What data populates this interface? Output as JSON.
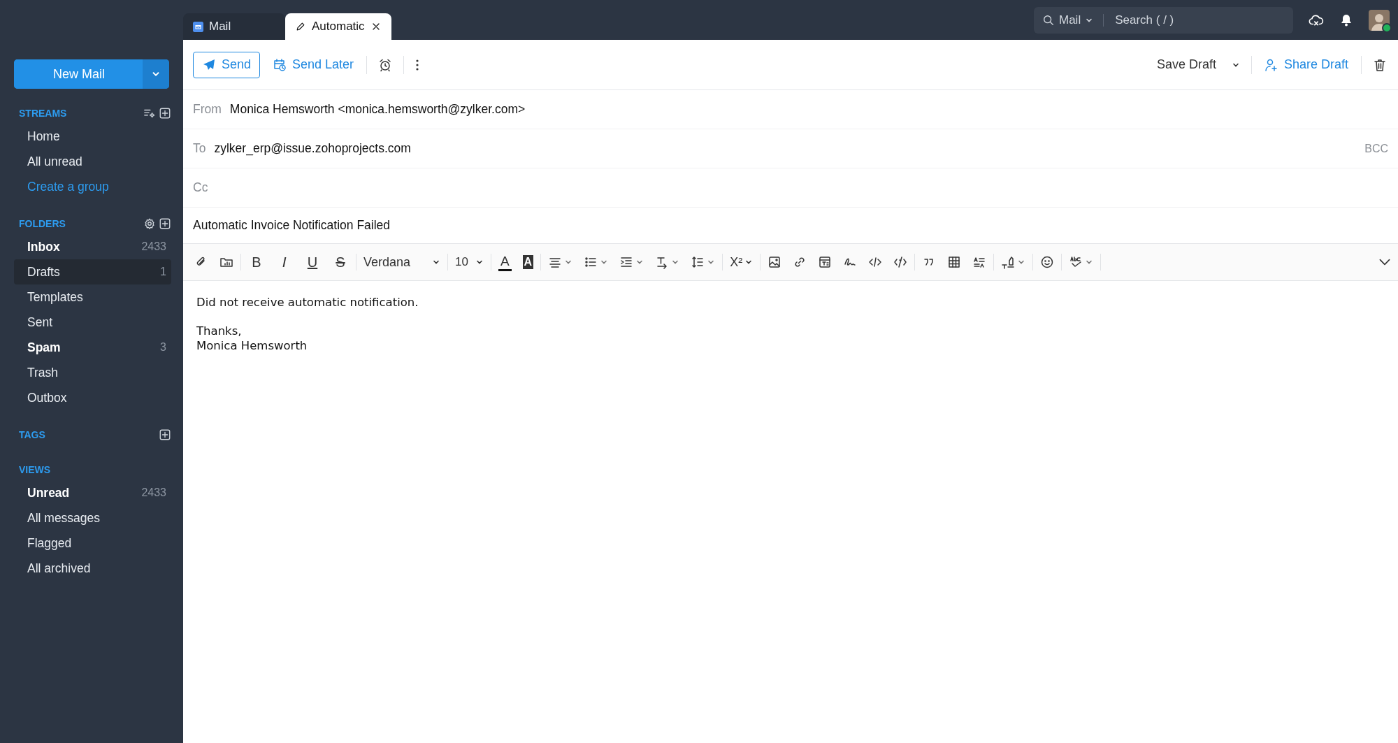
{
  "tabs": [
    {
      "label": "Mail",
      "kind": "mail",
      "selected": false,
      "closable": false
    },
    {
      "label": "Automatic",
      "kind": "draft",
      "selected": true,
      "closable": true
    }
  ],
  "search": {
    "scope": "Mail",
    "placeholder": "Search ( / )"
  },
  "new_mail": {
    "label": "New Mail"
  },
  "sidebar": {
    "sections": [
      {
        "title": "STREAMS",
        "actions": [
          {
            "kind": "filter-settings"
          },
          {
            "kind": "add"
          }
        ],
        "items": [
          {
            "label": "Home",
            "kind": "item",
            "bold": false,
            "selected": false
          },
          {
            "label": "All unread",
            "kind": "item",
            "bold": false,
            "selected": false
          },
          {
            "label": "Create a group",
            "kind": "link",
            "bold": false,
            "selected": false
          }
        ]
      },
      {
        "title": "FOLDERS",
        "actions": [
          {
            "kind": "settings"
          },
          {
            "kind": "add"
          }
        ],
        "items": [
          {
            "label": "Inbox",
            "kind": "item",
            "bold": true,
            "selected": false,
            "count": "2433"
          },
          {
            "label": "Drafts",
            "kind": "item",
            "bold": false,
            "selected": true,
            "count": "1"
          },
          {
            "label": "Templates",
            "kind": "item",
            "bold": false,
            "selected": false
          },
          {
            "label": "Sent",
            "kind": "item",
            "bold": false,
            "selected": false
          },
          {
            "label": "Spam",
            "kind": "item",
            "bold": true,
            "selected": false,
            "count": "3"
          },
          {
            "label": "Trash",
            "kind": "item",
            "bold": false,
            "selected": false
          },
          {
            "label": "Outbox",
            "kind": "item",
            "bold": false,
            "selected": false
          }
        ]
      },
      {
        "title": "TAGS",
        "actions": [
          {
            "kind": "add"
          }
        ]
      },
      {
        "title": "VIEWS",
        "items": [
          {
            "label": "Unread",
            "kind": "item",
            "bold": true,
            "selected": false,
            "count": "2433"
          },
          {
            "label": "All messages",
            "kind": "item",
            "bold": false,
            "selected": false
          },
          {
            "label": "Flagged",
            "kind": "item",
            "bold": false,
            "selected": false
          },
          {
            "label": "All archived",
            "kind": "item",
            "bold": false,
            "selected": false
          }
        ]
      }
    ]
  },
  "compose": {
    "send": "Send",
    "send_later": "Send Later",
    "save_draft": "Save Draft",
    "share_draft": "Share Draft",
    "from": {
      "label": "From",
      "value": "Monica Hemsworth <monica.hemsworth@zylker.com>"
    },
    "to": {
      "label": "To",
      "value": "zylker_erp@issue.zohoprojects.com",
      "bcc": "BCC"
    },
    "cc": {
      "label": "Cc"
    },
    "subject": "Automatic Invoice Notification Failed",
    "toolbar": [
      {
        "kind": "attach"
      },
      {
        "kind": "cloud-attach"
      },
      {
        "kind": "sep"
      },
      {
        "kind": "bold",
        "text": "B"
      },
      {
        "kind": "italic",
        "text": "I"
      },
      {
        "kind": "underline",
        "text": "U"
      },
      {
        "kind": "strike",
        "text": "S"
      },
      {
        "kind": "sep"
      },
      {
        "kind": "font",
        "text": "Verdana",
        "menu": true
      },
      {
        "kind": "sep"
      },
      {
        "kind": "size",
        "text": "10",
        "menu": true
      },
      {
        "kind": "sep"
      },
      {
        "kind": "font-color",
        "text": "A"
      },
      {
        "kind": "bg-color",
        "text": "A"
      },
      {
        "kind": "sep"
      },
      {
        "kind": "align",
        "menu": true
      },
      {
        "kind": "list",
        "menu": true
      },
      {
        "kind": "indent",
        "menu": true
      },
      {
        "kind": "direction",
        "menu": true
      },
      {
        "kind": "line-spacing",
        "menu": true
      },
      {
        "kind": "sep"
      },
      {
        "kind": "superscript",
        "text": "X²",
        "menu": true
      },
      {
        "kind": "sep"
      },
      {
        "kind": "image"
      },
      {
        "kind": "link"
      },
      {
        "kind": "template"
      },
      {
        "kind": "signature"
      },
      {
        "kind": "code"
      },
      {
        "kind": "snippet"
      },
      {
        "kind": "sep"
      },
      {
        "kind": "quote"
      },
      {
        "kind": "table"
      },
      {
        "kind": "format"
      },
      {
        "kind": "sep"
      },
      {
        "kind": "highlight",
        "menu": true
      },
      {
        "kind": "sep"
      },
      {
        "kind": "emoji"
      },
      {
        "kind": "sep"
      },
      {
        "kind": "spellcheck",
        "menu": true
      },
      {
        "kind": "sep"
      }
    ],
    "body": [
      {
        "lines": [
          "Did not receive automatic notification."
        ]
      },
      {
        "lines": [
          "Thanks,",
          "Monica Hemsworth"
        ]
      }
    ]
  }
}
